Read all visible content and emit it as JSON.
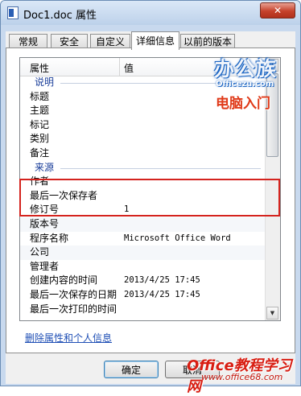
{
  "window": {
    "title": "Doc1.doc 属性",
    "close_label": "✕"
  },
  "tabs": [
    {
      "label": "常规"
    },
    {
      "label": "安全"
    },
    {
      "label": "自定义"
    },
    {
      "label": "详细信息",
      "active": true
    },
    {
      "label": "以前的版本"
    }
  ],
  "columns": {
    "property": "属性",
    "value": "值"
  },
  "rows": [
    {
      "type": "group",
      "label": "说明"
    },
    {
      "name": "标题",
      "value": ""
    },
    {
      "name": "主题",
      "value": ""
    },
    {
      "name": "标记",
      "value": ""
    },
    {
      "name": "类别",
      "value": ""
    },
    {
      "name": "备注",
      "value": ""
    },
    {
      "type": "group",
      "label": "来源"
    },
    {
      "name": "作者",
      "value": ""
    },
    {
      "name": "最后一次保存者",
      "value": ""
    },
    {
      "name": "修订号",
      "value": "1"
    },
    {
      "name": "版本号",
      "value": ""
    },
    {
      "name": "程序名称",
      "value": "Microsoft Office Word"
    },
    {
      "name": "公司",
      "value": ""
    },
    {
      "name": "管理者",
      "value": ""
    },
    {
      "name": "创建内容的时间",
      "value": "2013/4/25 17:45"
    },
    {
      "name": "最后一次保存的日期",
      "value": "2013/4/25 17:45"
    },
    {
      "name": "最后一次打印的时间",
      "value": ""
    }
  ],
  "remove_link": "删除属性和个人信息",
  "buttons": {
    "ok": "确定",
    "cancel": "取消"
  },
  "overlay_logo": {
    "brand": "办公族",
    "url": "Officezu.com",
    "tagline": "电脑入门"
  },
  "watermark": {
    "text": "Office教程学习网",
    "url": "www.office68.com"
  },
  "colors": {
    "highlight_box": "#d4231e",
    "group_header": "#1a3e9a",
    "link": "#1f4fb5"
  }
}
